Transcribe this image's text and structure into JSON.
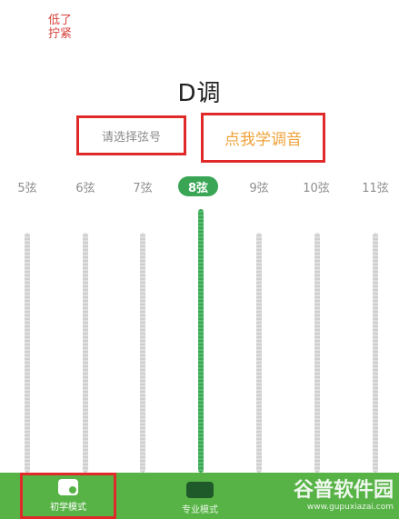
{
  "hint": {
    "line1": "低了",
    "line2": "拧紧"
  },
  "key_title": "D调",
  "select_string_label": "请选择弦号",
  "learn_tuning_label": "点我学调音",
  "strings": [
    {
      "label": "5弦",
      "active": false
    },
    {
      "label": "6弦",
      "active": false
    },
    {
      "label": "7弦",
      "active": false
    },
    {
      "label": "8弦",
      "active": true
    },
    {
      "label": "9弦",
      "active": false
    },
    {
      "label": "10弦",
      "active": false
    },
    {
      "label": "11弦",
      "active": false
    }
  ],
  "bottom_nav": [
    {
      "label": "初学模式",
      "icon": "beginner-mode-icon",
      "active": true
    },
    {
      "label": "专业模式",
      "icon": "pro-mode-icon",
      "active": false
    }
  ],
  "watermark": {
    "text": "谷普软件园",
    "url": "www.gupuxiazai.com"
  },
  "colors": {
    "accent_green": "#3aa655",
    "bar_green": "#58b347",
    "highlight_red": "#e02a2a",
    "hint_red": "#d8403a",
    "learn_orange": "#f0a23a"
  }
}
